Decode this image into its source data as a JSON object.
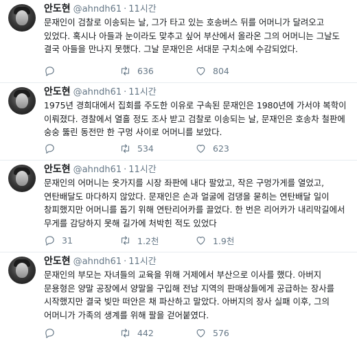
{
  "tweets": [
    {
      "name": "안도현",
      "handle": "@ahndh61",
      "separator": "·",
      "time": "11시간",
      "text": "문재인이 검찰로 이송되는 날, 그가 타고 있는 호송버스 뒤를 어머니가 달려오고 있었다. 혹시나 아들과 눈이라도 맞추고 싶어 부산에서 올라온 그의 어머니는 그날도 결국 아들을 만나지 못했다. 그날 문재인은 서대문 구치소에 수감되었다.",
      "replies": "",
      "retweets": "636",
      "likes": "804"
    },
    {
      "name": "안도현",
      "handle": "@ahndh61",
      "separator": "·",
      "time": "11시간",
      "text": "1975년 경희대에서 집회를 주도한 이유로 구속된 문재인은 1980년에 가서야 복학이 이뤄졌다. 경찰에서 열흘 정도 조사 받고 검찰로 이송되는 날, 문재인은 호송차 철판에 숭숭 뚫린 동전만 한 구멍 사이로 어머니를 보았다.",
      "replies": "",
      "retweets": "534",
      "likes": "623"
    },
    {
      "name": "안도현",
      "handle": "@ahndh61",
      "separator": "·",
      "time": "11시간",
      "text": "문재인의 어머니는 옷가지를 시장 좌판에 내다 팔았고, 작은 구멍가게를 열었고, 연탄배달도 마다하지 않았다. 문재인은 손과 얼굴에 검댕을 묻히는 연탄배달 일이 창피했지만 어머니를 돕기 위해 연탄리어카를 끌었다. 한 번은 리어카가 내리막길에서 무게를 감당하지 못해 길가에 처박힌 적도 있었다",
      "replies": "31",
      "retweets": "1.2천",
      "likes": "1.9천"
    },
    {
      "name": "안도현",
      "handle": "@ahndh61",
      "separator": "·",
      "time": "11시간",
      "text": "문재인의 부모는 자녀들의 교육을 위해 거제에서 부산으로 이사를 했다. 아버지 문용형은 양말 공장에서 양말을 구입해 전남 지역의 판매상들에게 공급하는 장사를 시작했지만 결국 빚만 떠안은 채 파산하고 말았다. 아버지의 장사 실패 이후, 그의 어머니가 가족의 생계를 위해 팔을 걷어붙였다.",
      "replies": "",
      "retweets": "442",
      "likes": "576"
    }
  ],
  "icons": {
    "reply": "reply-icon",
    "retweet": "retweet-icon",
    "like": "heart-icon"
  },
  "colors": {
    "text": "#14171a",
    "muted": "#657786",
    "divider": "#e6ecf0"
  }
}
